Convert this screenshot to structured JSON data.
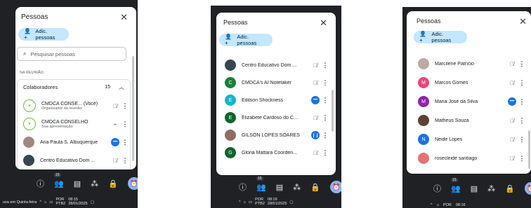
{
  "panels": [
    {
      "title": "Pessoas",
      "close": "✕",
      "add_label": "Adic. pessoas",
      "search_placeholder": "Pesquisar pessoas",
      "section": "NA REUNIÃO",
      "group_label": "Colaboradores",
      "group_count": "15",
      "participants": [
        {
          "name": "CMDCA CONSE... (Você)",
          "sub": "Organizador da reunião",
          "avatar": "logo",
          "mic": "off",
          "color": "#7cb342"
        },
        {
          "name": "CMDCA CONSELHO",
          "sub": "Sua apresentação",
          "avatar": "logo",
          "mic": "present",
          "color": "#7cb342"
        },
        {
          "name": "Ana Paula S. Albuquerque",
          "sub": "",
          "avatar": "photo",
          "mic": "speaking",
          "color": "#a1887f"
        },
        {
          "name": "Centro Educativo Dom ...",
          "sub": "",
          "avatar": "photo",
          "mic": "off",
          "color": "#37474f"
        }
      ],
      "bar_badge": "15",
      "taskbar_left": "uva em Quinta-feira",
      "lang": "POR",
      "lang2": "PTB2",
      "time": "08:15",
      "date": "28/01/2025"
    },
    {
      "title": "Pessoas",
      "close": "✕",
      "add_label": "Adic. pessoas",
      "participants": [
        {
          "name": "Centro Educativo Dom ...",
          "avatar": "photo",
          "mic": "off",
          "color": "#37474f",
          "letter": ""
        },
        {
          "name": "CMDCA's AI Notetaker",
          "avatar": "letter",
          "mic": "off",
          "color": "#188038",
          "letter": "C"
        },
        {
          "name": "Edilson Shockness",
          "avatar": "letter",
          "mic": "speaking",
          "color": "#12b5cb",
          "letter": "E"
        },
        {
          "name": "Elizabete Cardoso do C...",
          "avatar": "letter",
          "mic": "off",
          "color": "#0d652d",
          "letter": "E"
        },
        {
          "name": "GILSON LOPES SOARES",
          "avatar": "photo",
          "mic": "speaking",
          "color": "#8d6e63",
          "letter": ""
        },
        {
          "name": "Glória Mattara Coorden...",
          "avatar": "letter",
          "mic": "off",
          "color": "#0d652d",
          "letter": "G"
        }
      ],
      "bar_badge": "15",
      "lang": "POR",
      "lang2": "PTB2",
      "time": "08:16",
      "date": "28/01/2025"
    },
    {
      "title": "Pessoas",
      "close": "✕",
      "add_label": "Adic. pessoas",
      "participants": [
        {
          "name": "Marcilene Patrício",
          "avatar": "photo",
          "mic": "off",
          "color": "#bcaaa4",
          "letter": ""
        },
        {
          "name": "Marcos Gomes",
          "avatar": "letter",
          "mic": "off",
          "color": "#e8457d",
          "letter": "M"
        },
        {
          "name": "Maria José da Silva",
          "avatar": "letter",
          "mic": "speaking",
          "color": "#8e24aa",
          "letter": "M"
        },
        {
          "name": "Matheus Souza",
          "avatar": "photo",
          "mic": "off",
          "color": "#5d4037",
          "letter": ""
        },
        {
          "name": "Neide Lopes",
          "avatar": "letter",
          "mic": "off",
          "color": "#1a73e8",
          "letter": "N"
        },
        {
          "name": "rosecleide santiago",
          "avatar": "photo",
          "mic": "off",
          "color": "#e57373",
          "letter": ""
        }
      ],
      "bar_badge": "15",
      "lang": "POR",
      "time": "08:16"
    }
  ],
  "colors": {
    "accent": "#1a73e8",
    "chip": "#c2e7ff",
    "dark": "#202124"
  }
}
